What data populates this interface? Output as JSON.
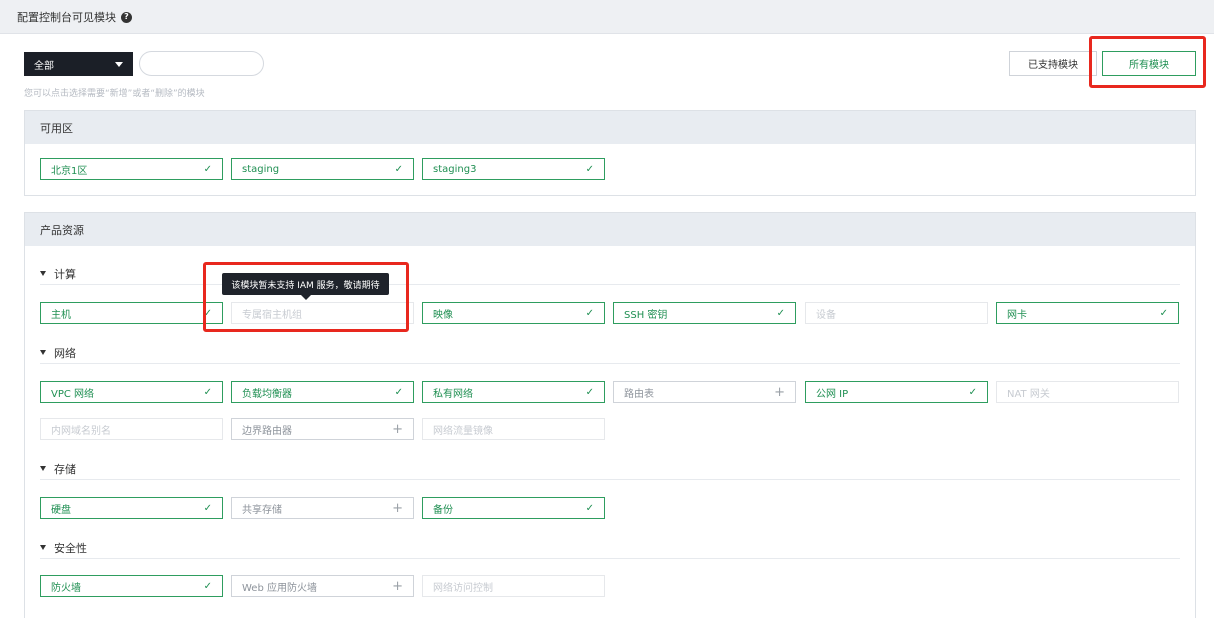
{
  "header": {
    "title": "配置控制台可见模块"
  },
  "filter": {
    "selected": "全部",
    "search_value": "",
    "hint": "您可以点击选择需要“新增”或者“删除”的模块"
  },
  "buttons": {
    "supported": "已支持模块",
    "all": "所有模块"
  },
  "tooltip": {
    "text": "该模块暂未支持 IAM 服务，敬请期待"
  },
  "sections": {
    "region": {
      "title": "可用区",
      "items": [
        {
          "label": "北京1区",
          "state": "selected",
          "icon": "check-icon"
        },
        {
          "label": "staging",
          "state": "selected",
          "icon": "check-icon"
        },
        {
          "label": "staging3",
          "state": "selected",
          "icon": "check-icon"
        }
      ]
    },
    "product": {
      "title": "产品资源",
      "groups": [
        {
          "title": "计算",
          "items": [
            {
              "label": "主机",
              "state": "selected",
              "icon": "check-icon"
            },
            {
              "label": "专属宿主机组",
              "state": "disabled"
            },
            {
              "label": "映像",
              "state": "selected",
              "icon": "check-icon"
            },
            {
              "label": "SSH 密钥",
              "state": "selected",
              "icon": "check-icon"
            },
            {
              "label": "设备",
              "state": "disabled"
            },
            {
              "label": "网卡",
              "state": "selected",
              "icon": "check-icon"
            }
          ]
        },
        {
          "title": "网络",
          "items": [
            {
              "label": "VPC 网络",
              "state": "selected",
              "icon": "check-icon"
            },
            {
              "label": "负载均衡器",
              "state": "selected",
              "icon": "check-icon"
            },
            {
              "label": "私有网络",
              "state": "selected",
              "icon": "check-icon"
            },
            {
              "label": "路由表",
              "state": "add",
              "icon": "plus-icon"
            },
            {
              "label": "公网 IP",
              "state": "selected",
              "icon": "check-icon"
            },
            {
              "label": "NAT 网关",
              "state": "disabled"
            },
            {
              "label": "内网域名别名",
              "state": "disabled"
            },
            {
              "label": "边界路由器",
              "state": "add",
              "icon": "plus-icon"
            },
            {
              "label": "网络流量镜像",
              "state": "disabled"
            }
          ]
        },
        {
          "title": "存储",
          "items": [
            {
              "label": "硬盘",
              "state": "selected",
              "icon": "check-icon"
            },
            {
              "label": "共享存储",
              "state": "add",
              "icon": "plus-icon"
            },
            {
              "label": "备份",
              "state": "selected",
              "icon": "check-icon"
            }
          ]
        },
        {
          "title": "安全性",
          "items": [
            {
              "label": "防火墙",
              "state": "selected",
              "icon": "check-icon"
            },
            {
              "label": "Web 应用防火墙",
              "state": "add",
              "icon": "plus-icon"
            },
            {
              "label": "网络访问控制",
              "state": "disabled"
            }
          ]
        }
      ]
    }
  },
  "colors": {
    "accent": "#2e9d5f",
    "highlight": "#e8281e",
    "dark": "#1b1f27"
  }
}
